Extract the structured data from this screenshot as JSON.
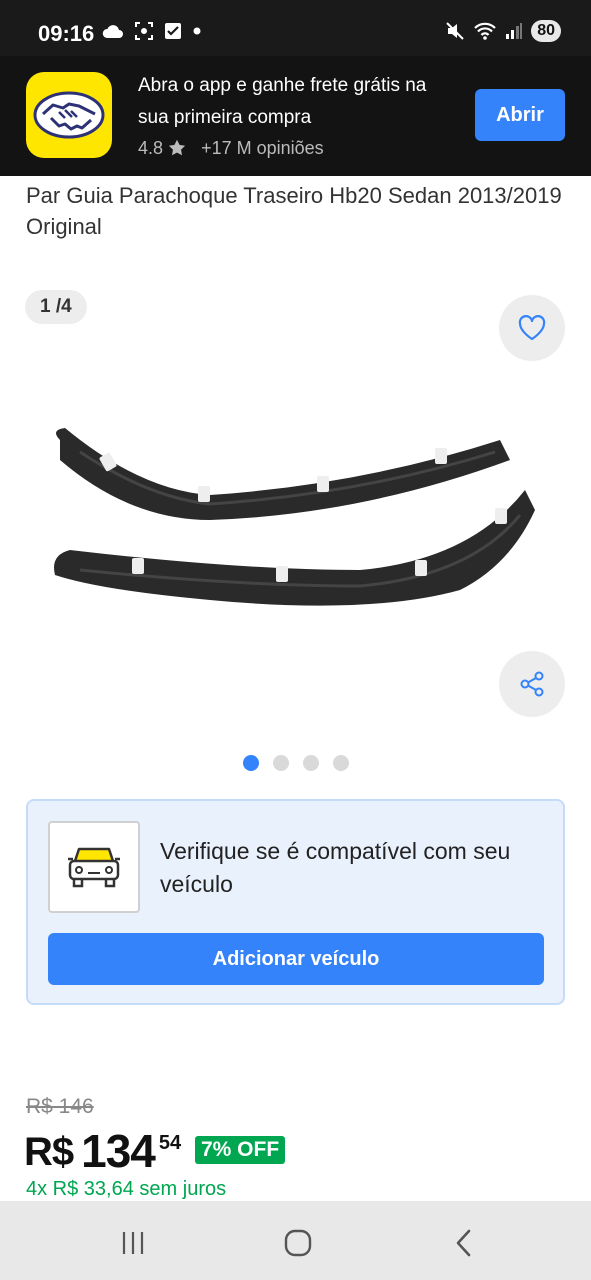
{
  "status_bar": {
    "time": "09:16",
    "battery": "80",
    "icons_left": [
      "cloud-icon",
      "screenshot-icon",
      "check-icon",
      "dot-icon"
    ],
    "icons_right": [
      "mute-icon",
      "wifi-icon",
      "signal-icon"
    ]
  },
  "app_banner": {
    "message": "Abra o app e ganhe frete grátis na sua primeira compra",
    "rating": "4.8",
    "reviews": "+17 M opiniões",
    "open_label": "Abrir",
    "logo_icon": "handshake-icon",
    "brand_color": "#ffe600"
  },
  "product": {
    "title": "Par Guia Parachoque Traseiro Hb20 Sedan 2013/2019 Original",
    "image_counter": "1 /4",
    "image_count": 4,
    "active_image": 1
  },
  "compatibility": {
    "text": "Verifique se é compatível com seu veículo",
    "button_label": "Adicionar veículo",
    "icon": "car-icon"
  },
  "pricing": {
    "old_price": "R$ 146",
    "currency": "R$",
    "price_int": "134",
    "price_cents": "54",
    "discount": "7% OFF",
    "installments": "4x R$ 33,64 sem juros"
  },
  "nav_bar": {
    "items": [
      "recent-apps-icon",
      "home-icon",
      "back-icon"
    ]
  },
  "colors": {
    "accent": "#3483fa",
    "success": "#00a650"
  }
}
